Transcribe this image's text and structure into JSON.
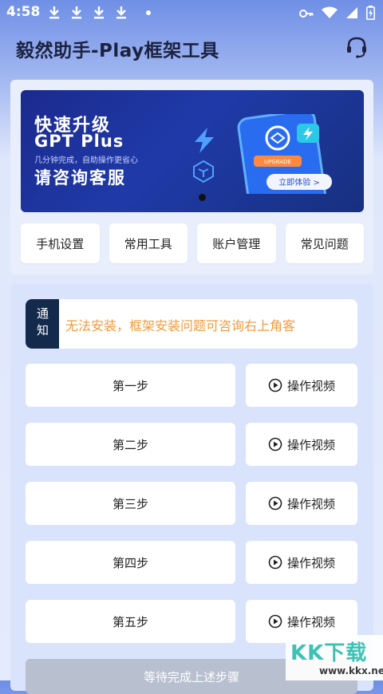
{
  "status_bar": {
    "time": "4:58",
    "left_icons": [
      "download-icon",
      "download-icon",
      "download-icon",
      "download-icon"
    ],
    "right_icons": [
      "key-icon",
      "wifi-icon",
      "signal-icon",
      "battery-icon"
    ]
  },
  "header": {
    "title": "毅然助手-Play框架工具",
    "support_icon": "headset-icon"
  },
  "banner": {
    "title": "快速升级",
    "subtitle": "GPT Plus",
    "tagline": "几分钟完成，自助操作更省心",
    "cta": "请咨询客服",
    "phone_badge": "UPGRADE",
    "phone_button": "立即体验 >",
    "carousel_active_index": 0
  },
  "quick_buttons": [
    {
      "label": "手机设置"
    },
    {
      "label": "常用工具"
    },
    {
      "label": "账户管理"
    },
    {
      "label": "常见问题"
    }
  ],
  "notice": {
    "tag": "通知",
    "text": "无法安装，框架安装问题可咨询右上角客"
  },
  "steps": [
    {
      "label": "第一步",
      "video_label": "操作视频"
    },
    {
      "label": "第二步",
      "video_label": "操作视频"
    },
    {
      "label": "第三步",
      "video_label": "操作视频"
    },
    {
      "label": "第四步",
      "video_label": "操作视频"
    },
    {
      "label": "第五步",
      "video_label": "操作视频"
    }
  ],
  "wait_button": "等待完成上述步骤",
  "watermark": {
    "logo": "KK下载",
    "url": "www.kkx.net"
  },
  "colors": {
    "notice_tag_bg": "#132a4d",
    "notice_text": "#f29a3c",
    "banner_bg": "#1f3aa8"
  }
}
